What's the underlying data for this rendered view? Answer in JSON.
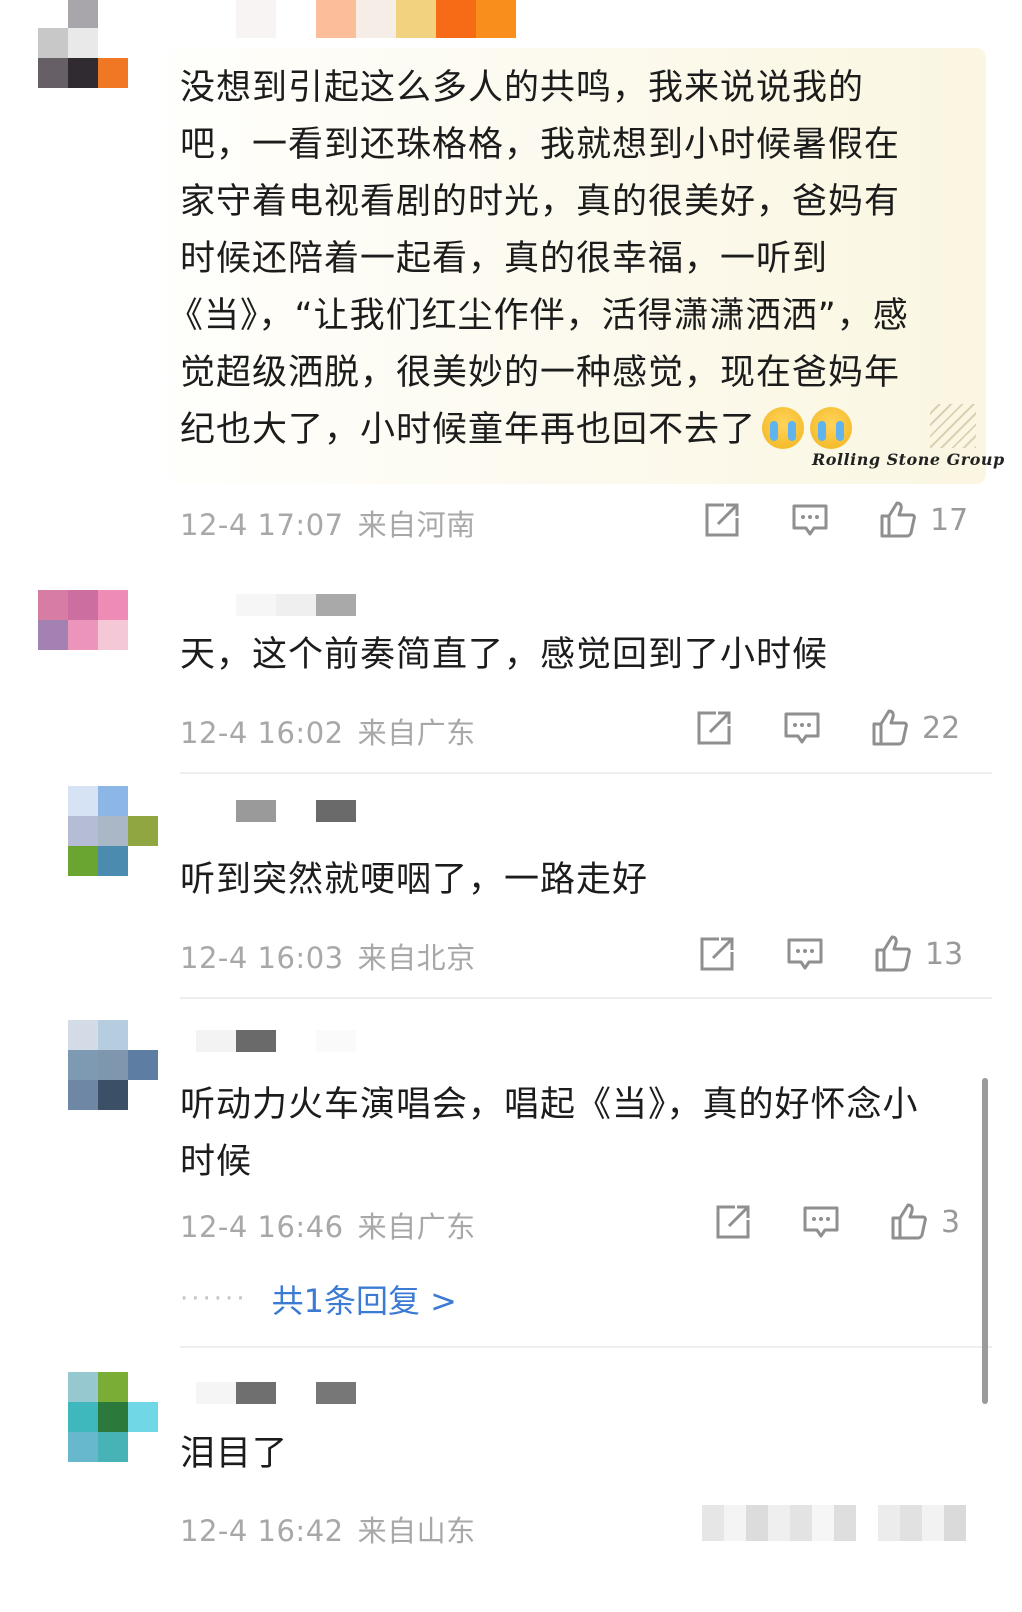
{
  "comments": [
    {
      "lines": [
        "没想到引起这么多人的共鸣，我来说说我的",
        "吧，一看到还珠格格，我就想到小时候暑假在",
        "家守着电视看剧的时光，真的很美好，爸妈有",
        "时候还陪着一起看，真的很幸福，一听到",
        "《当》，“让我们红尘作伴，活得潇潇洒洒”，感",
        "觉超级洒脱，很美妙的一种感觉，现在爸妈年",
        "纪也大了，小时候童年再也回不去了"
      ],
      "emojis": [
        "crying-emoji",
        "crying-emoji"
      ],
      "time": "12-4 17:07",
      "location": "来自河南",
      "likes": "17",
      "avatar_colors": [
        "#ffffff",
        "#a9a6ab",
        "#ffffff",
        "#ffffff",
        "#c8c8c8",
        "#e9e9e9",
        "#ffffff",
        "#ffffff",
        "#666066",
        "#2f2b30",
        "#f07825",
        "#ffffff",
        "#ffffff",
        "#ffffff",
        "#ffffff",
        "#ffffff"
      ]
    },
    {
      "lines": [
        "天，这个前奏简直了，感觉回到了小时候"
      ],
      "time": "12-4 16:02",
      "location": "来自广东",
      "likes": "22",
      "avatar_colors": [
        "#ffffff",
        "#ffffff",
        "#ffffff",
        "#ffffff",
        "#d77ca3",
        "#cc6fa0",
        "#ef8cb6",
        "#ffffff",
        "#a381b2",
        "#ed94bb",
        "#f5c8d8",
        "#ffffff",
        "#ffffff",
        "#ffffff",
        "#ffffff",
        "#ffffff"
      ]
    },
    {
      "lines": [
        "听到突然就哽咽了，一路走好"
      ],
      "time": "12-4 16:03",
      "location": "来自北京",
      "likes": "13",
      "avatar_colors": [
        "#ffffff",
        "#d5e3f4",
        "#8bb6e6",
        "#ffffff",
        "#ffffff",
        "#b5bcd6",
        "#a9b7c7",
        "#8fa641",
        "#ffffff",
        "#6aa532",
        "#4c8bb0",
        "#ffffff",
        "#ffffff",
        "#ffffff",
        "#ffffff",
        "#ffffff"
      ]
    },
    {
      "lines": [
        "听动力火车演唱会，唱起《当》，真的好怀念小",
        "时候"
      ],
      "time": "12-4 16:46",
      "location": "来自广东",
      "likes": "3",
      "reply": "共1条回复 >",
      "reply_dots": "······",
      "avatar_colors": [
        "#ffffff",
        "#d3dce6",
        "#b6ccdf",
        "#ffffff",
        "#ffffff",
        "#7e99b2",
        "#7f97ae",
        "#5d7ea2",
        "#ffffff",
        "#6e87a5",
        "#3b4f66",
        "#ffffff",
        "#ffffff",
        "#ffffff",
        "#ffffff",
        "#ffffff"
      ]
    },
    {
      "lines": [
        "泪目了"
      ],
      "time": "12-4 16:42",
      "location": "来自山东",
      "likes": "",
      "avatar_colors": [
        "#ffffff",
        "#96c8d0",
        "#79ad35",
        "#ffffff",
        "#ffffff",
        "#3fb8bd",
        "#2b7a3c",
        "#6fd7e6",
        "#ffffff",
        "#68b8cd",
        "#47b3b6",
        "#ffffff",
        "#ffffff",
        "#ffffff",
        "#ffffff",
        "#ffffff"
      ]
    }
  ],
  "watermark": "Rolling Stone Group",
  "colors": {
    "text": "#1c1c1c",
    "meta": "#a8a8a8",
    "link": "#3c7bd4",
    "highlight": "#faf6e1"
  },
  "icons": [
    "share-icon",
    "comment-icon",
    "like-icon"
  ]
}
